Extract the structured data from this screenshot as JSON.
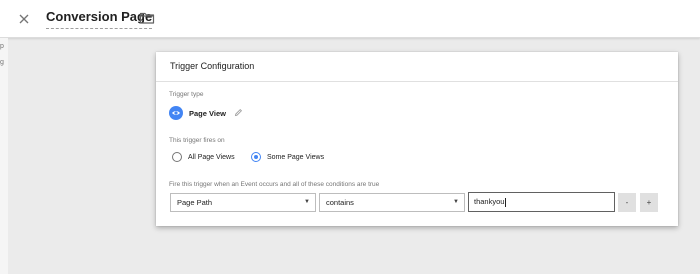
{
  "header": {
    "title": "Conversion Page",
    "close_icon": "close-icon",
    "folder_icon": "folder-icon"
  },
  "background": {
    "strip_fragments": [
      "p",
      "g"
    ]
  },
  "card": {
    "title": "Trigger Configuration",
    "trigger_type": {
      "label": "Trigger type",
      "value": "Page View",
      "icon": "eye-icon",
      "edit_icon": "pencil-icon"
    },
    "fires_on": {
      "label": "This trigger fires on",
      "options": [
        {
          "label": "All Page Views",
          "selected": false
        },
        {
          "label": "Some Page Views",
          "selected": true
        }
      ]
    },
    "condition": {
      "label": "Fire this trigger when an Event occurs and all of these conditions are true",
      "variable": "Page Path",
      "operator": "contains",
      "value": "thankyou",
      "remove_label": "-",
      "add_label": "+"
    }
  },
  "colors": {
    "accent": "#4285f4",
    "background": "#ebebeb"
  }
}
